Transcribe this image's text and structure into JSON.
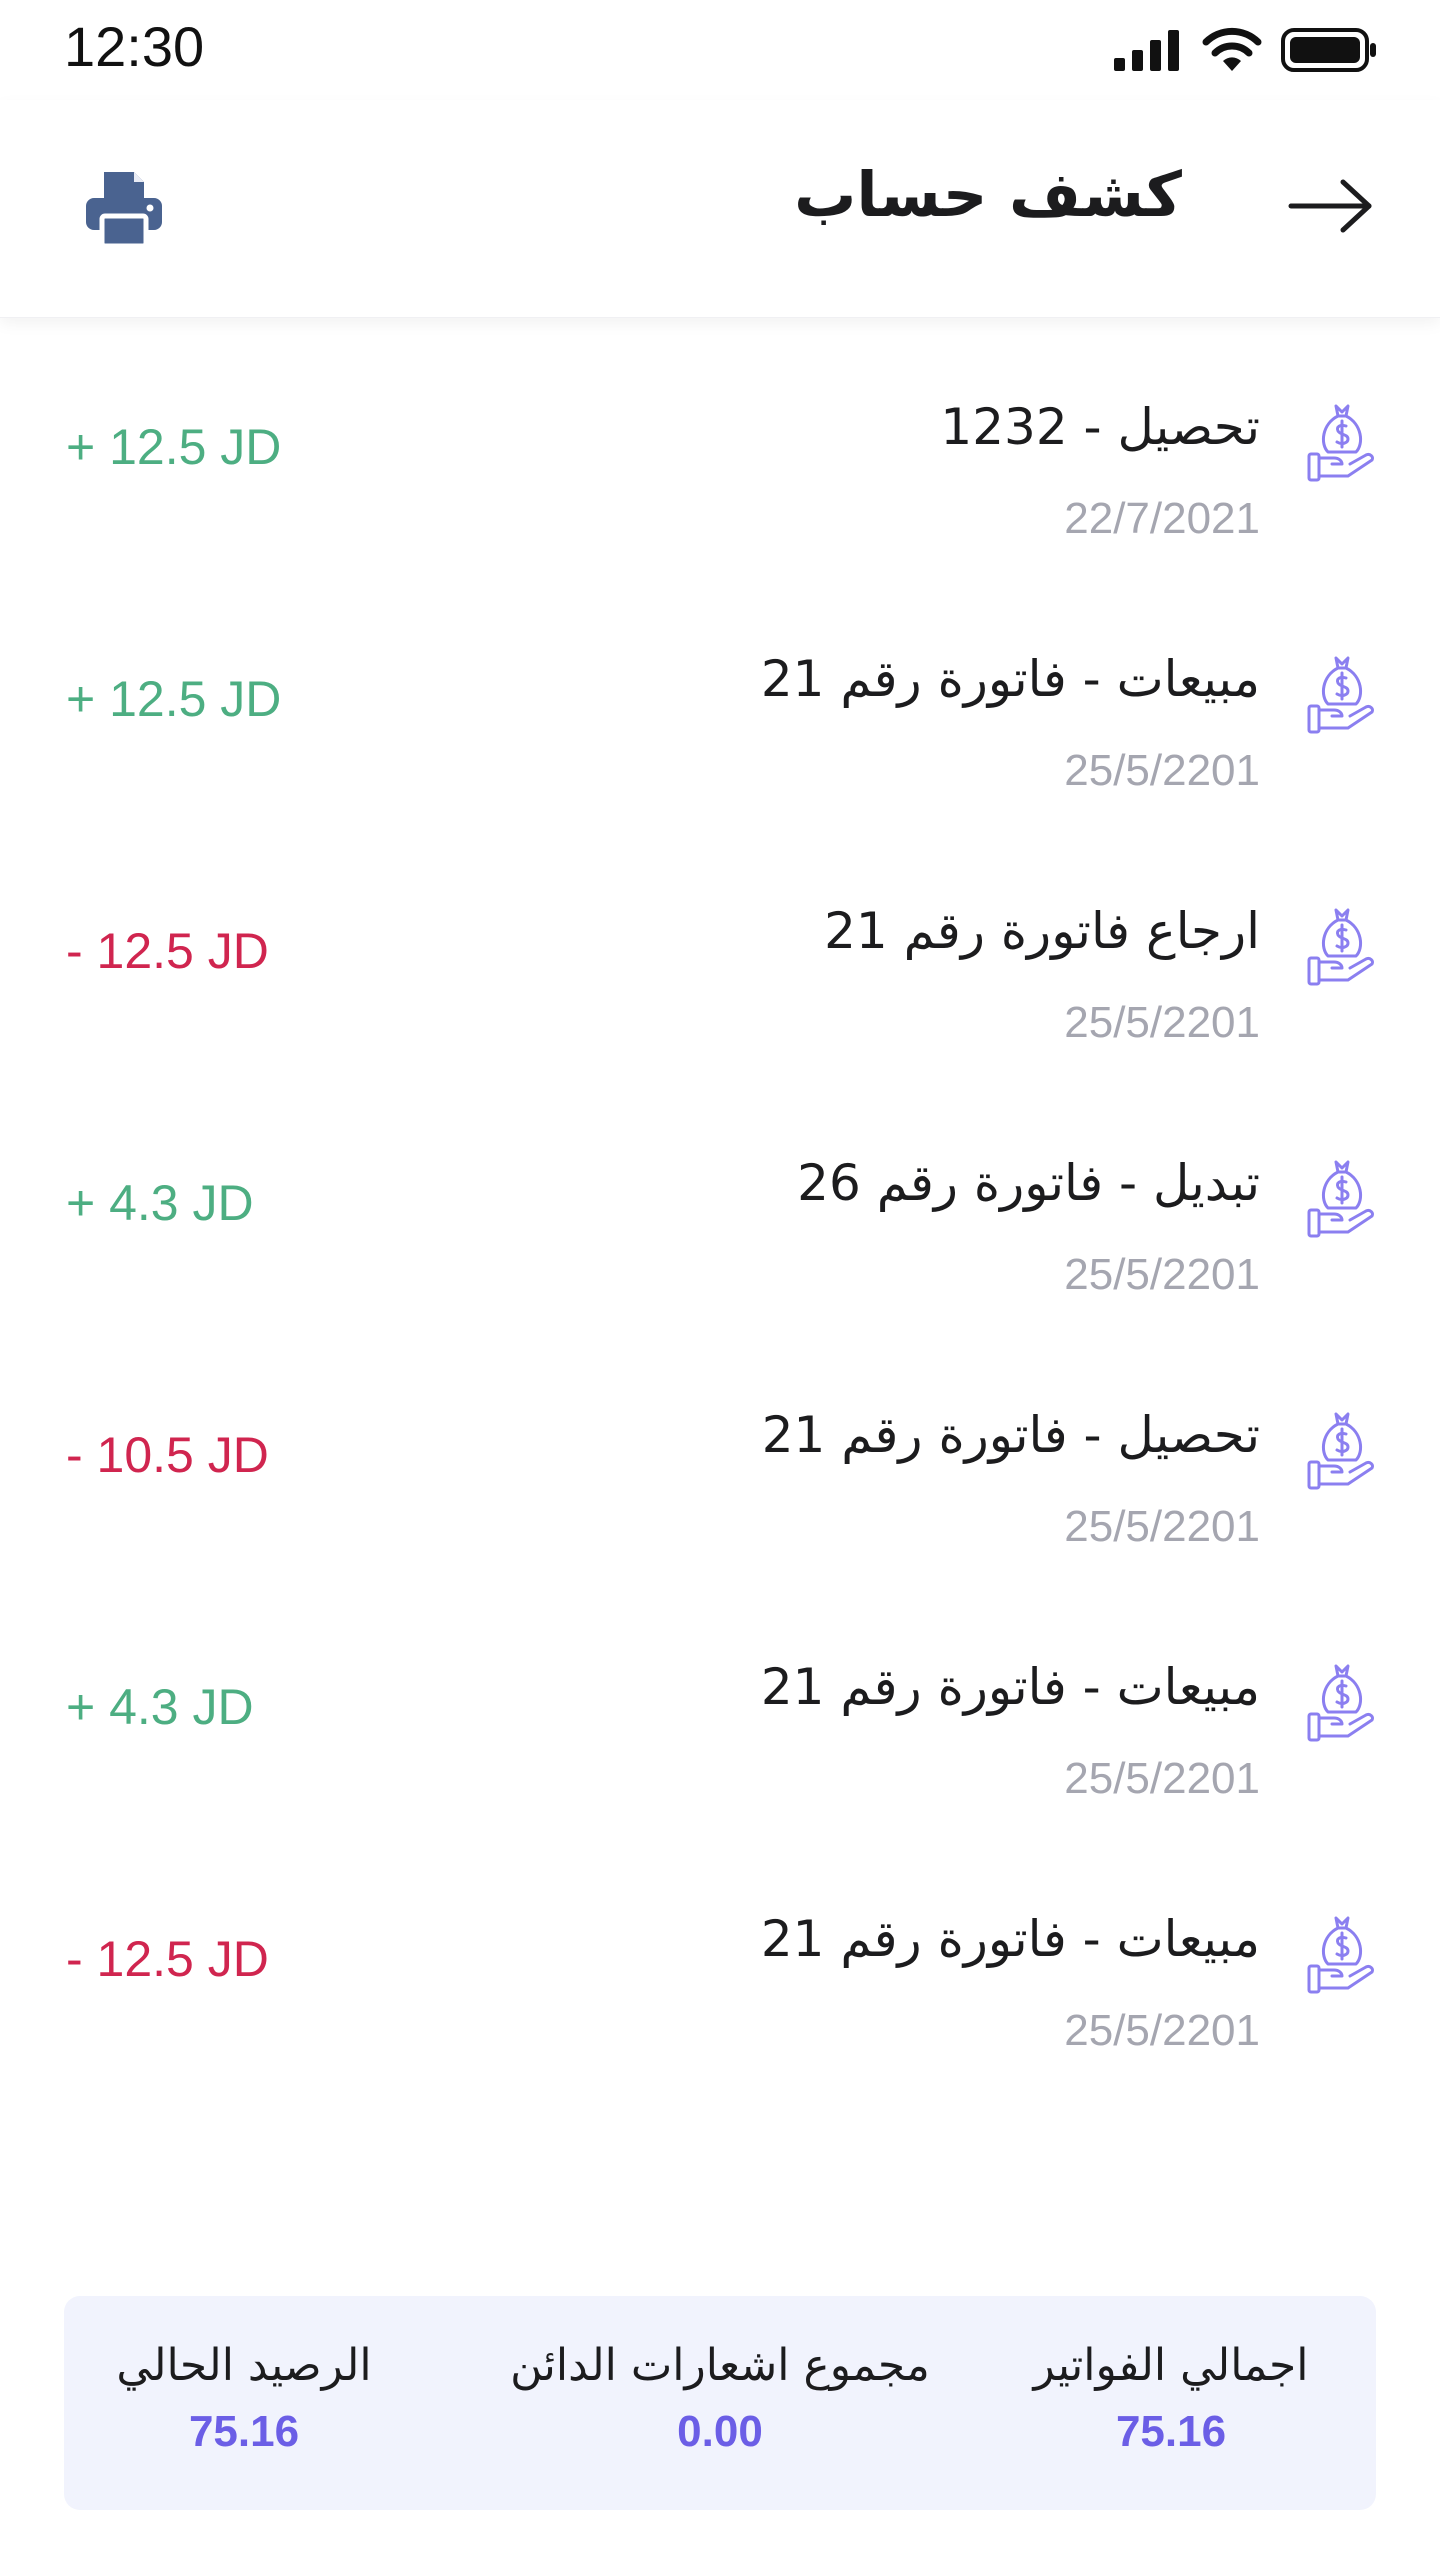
{
  "status_bar": {
    "time": "12:30",
    "icons": [
      "signal-icon",
      "wifi-icon",
      "battery-icon"
    ]
  },
  "header": {
    "title": "كشف حساب",
    "back_icon": "arrow-right-icon",
    "print_icon": "printer-icon"
  },
  "colors": {
    "positive": "#4dae82",
    "negative": "#d0254f",
    "accent": "#6b5ee6",
    "icon": "#8b7ff0",
    "printer": "#4a6390"
  },
  "transactions": [
    {
      "title": "تحصيل - 1232",
      "date": "22/7/2021",
      "amount": "+ 12.5 JD",
      "type": "positive"
    },
    {
      "title": "مبيعات - فاتورة رقم 21",
      "date": "25/5/2201",
      "amount": "+ 12.5 JD",
      "type": "positive"
    },
    {
      "title": "ارجاع فاتورة رقم 21",
      "date": "25/5/2201",
      "amount": "- 12.5 JD",
      "type": "negative"
    },
    {
      "title": "تبديل - فاتورة رقم 26",
      "date": "25/5/2201",
      "amount": "+ 4.3 JD",
      "type": "positive"
    },
    {
      "title": "تحصيل - فاتورة رقم 21",
      "date": "25/5/2201",
      "amount": "- 10.5 JD",
      "type": "negative"
    },
    {
      "title": "مبيعات - فاتورة رقم 21",
      "date": "25/5/2201",
      "amount": "+ 4.3 JD",
      "type": "positive"
    },
    {
      "title": "مبيعات - فاتورة رقم 21",
      "date": "25/5/2201",
      "amount": "- 12.5 JD",
      "type": "negative"
    }
  ],
  "summary": {
    "total_invoices_label": "اجمالي الفواتير",
    "total_invoices_value": "75.16",
    "credit_notes_label": "مجموع اشعارات الدائن",
    "credit_notes_value": "0.00",
    "current_balance_label": "الرصيد الحالي",
    "current_balance_value": "75.16"
  }
}
